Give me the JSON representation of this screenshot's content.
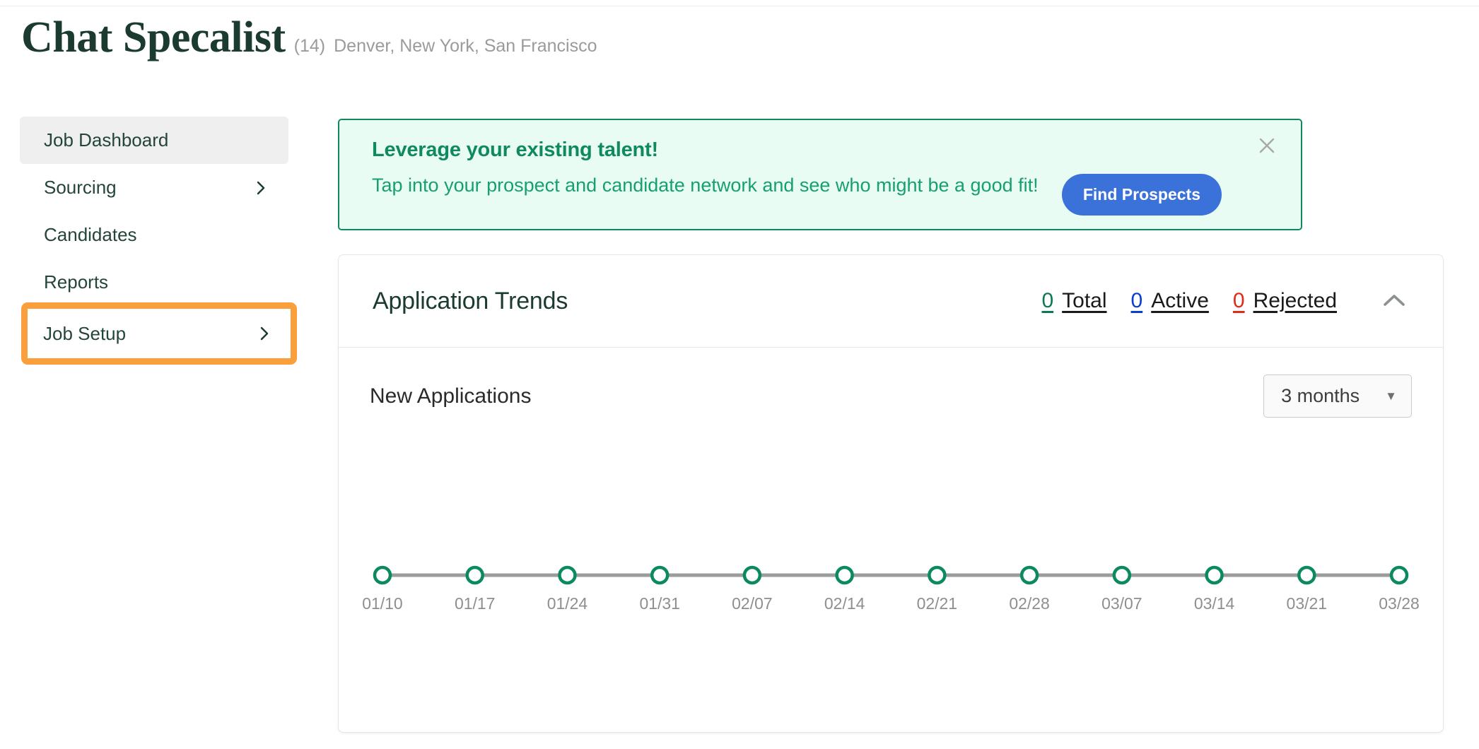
{
  "header": {
    "title": "Chat Specalist",
    "count": "(14)",
    "locations": "Denver, New York, San Francisco"
  },
  "sidebar": {
    "items": [
      {
        "label": "Job Dashboard",
        "has_chevron": false,
        "active": true
      },
      {
        "label": "Sourcing",
        "has_chevron": true,
        "active": false
      },
      {
        "label": "Candidates",
        "has_chevron": false,
        "active": false
      },
      {
        "label": "Reports",
        "has_chevron": false,
        "active": false
      },
      {
        "label": "Job Setup",
        "has_chevron": true,
        "active": false,
        "highlighted": true
      }
    ],
    "highlight_color": "#f9a03c"
  },
  "promo": {
    "title": "Leverage your existing talent!",
    "body": "Tap into your prospect and candidate network and see who might be a good fit!",
    "cta_label": "Find Prospects",
    "close_icon": "close-icon",
    "background": "#e9fcf3",
    "border_color": "#0f8a5f",
    "cta_color": "#3b72d9"
  },
  "trends_card": {
    "title": "Application Trends",
    "stats": [
      {
        "value": "0",
        "label": "Total",
        "color": "#0b7a54"
      },
      {
        "value": "0",
        "label": "Active",
        "color": "#0b3fd4"
      },
      {
        "value": "0",
        "label": "Rejected",
        "color": "#e02b16"
      }
    ],
    "collapse_icon": "chevron-up-icon",
    "chart_subtitle": "New Applications",
    "range_value": "3 months",
    "range_caret": "▼"
  },
  "chart_data": {
    "type": "line",
    "title": "New Applications",
    "categories": [
      "01/10",
      "01/17",
      "01/24",
      "01/31",
      "02/07",
      "02/14",
      "02/21",
      "02/28",
      "03/07",
      "03/14",
      "03/21",
      "03/28"
    ],
    "values": [
      0,
      0,
      0,
      0,
      0,
      0,
      0,
      0,
      0,
      0,
      0,
      0
    ],
    "xlabel": "",
    "ylabel": "",
    "ylim": [
      0,
      1
    ],
    "grid": false,
    "legend": false,
    "series_color": "#0b8a5f",
    "line_color": "#9a9c9c",
    "marker": "circle-outline"
  }
}
